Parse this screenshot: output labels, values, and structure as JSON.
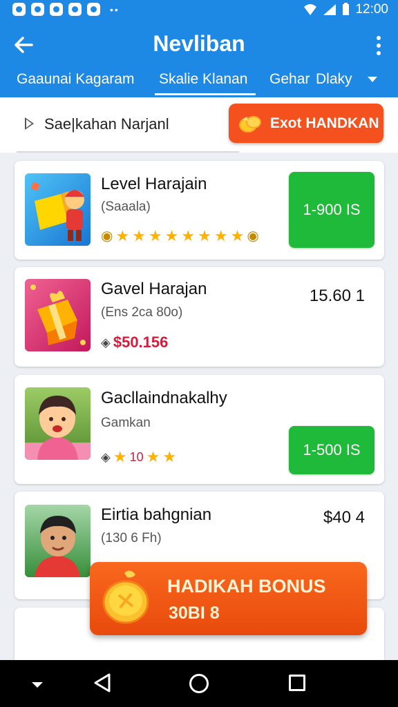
{
  "status_bar": {
    "time": "12:00"
  },
  "app_bar": {
    "title": "Nevliban"
  },
  "tabs": [
    {
      "label": "Gaaunai Kagaram"
    },
    {
      "label": "Skalie Klanan"
    },
    {
      "label": "Gehar"
    },
    {
      "label": "Dlaky"
    }
  ],
  "search": {
    "value": "Sae|kahan Narjanl"
  },
  "action_button": {
    "label": "Exot HANDKAN"
  },
  "items": [
    {
      "title": "Level Harajain",
      "subtitle": "(Saaala)",
      "button": "1-900 IS"
    },
    {
      "title": "Gavel Harajan",
      "subtitle": "(Ens 2ca 80o)",
      "price": "15.60 1",
      "red_price": "$50.156"
    },
    {
      "title": "Gacllaindnakalhy",
      "subtitle": "Gamkan",
      "rating_text": "10",
      "button": "1-500 IS"
    },
    {
      "title": "Eirtia bahgnian",
      "subtitle": "(130 6 Fh)",
      "price": "$40 4"
    }
  ],
  "bonus": {
    "title": "HADIKAH BONUS",
    "value": "30BI 8"
  },
  "colors": {
    "primary": "#1e88e5",
    "accent": "#f4511e",
    "green": "#1fba3a",
    "red_price": "#d81b3c",
    "star": "#ffb300"
  }
}
